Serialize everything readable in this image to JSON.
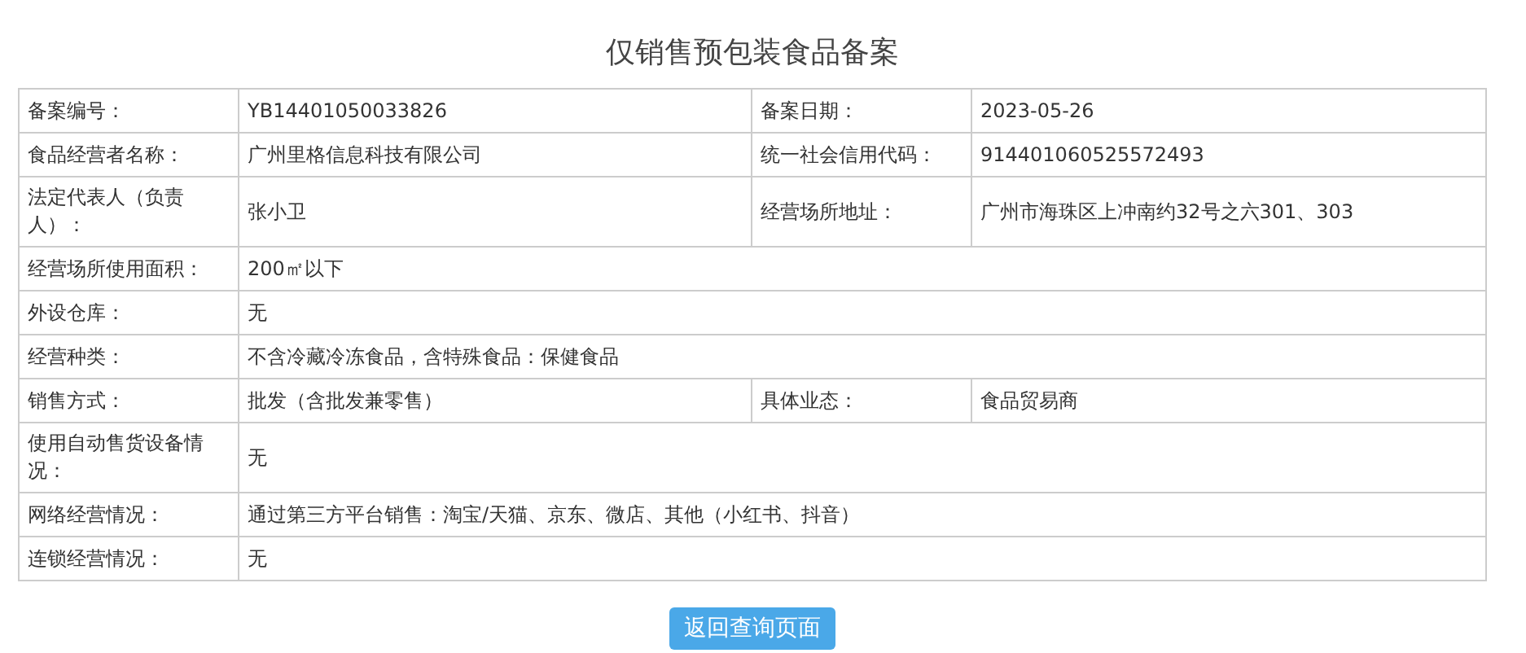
{
  "title": "仅销售预包装食品备案",
  "rows": [
    [
      {
        "label": "备案编号：",
        "value": "YB14401050033826"
      },
      {
        "label": "备案日期：",
        "value": "2023-05-26"
      }
    ],
    [
      {
        "label": "食品经营者名称：",
        "value": "广州里格信息科技有限公司"
      },
      {
        "label": "统一社会信用代码：",
        "value": "914401060525572493"
      }
    ],
    [
      {
        "label": "法定代表人（负责人）：",
        "value": "张小卫"
      },
      {
        "label": "经营场所地址：",
        "value": "广州市海珠区上冲南约32号之六301、303"
      }
    ],
    [
      {
        "label": "经营场所使用面积：",
        "value": "200㎡以下"
      }
    ],
    [
      {
        "label": "外设仓库：",
        "value": "无"
      }
    ],
    [
      {
        "label": "经营种类：",
        "value": "不含冷藏冷冻食品，含特殊食品：保健食品"
      }
    ],
    [
      {
        "label": "销售方式：",
        "value": "批发（含批发兼零售）"
      },
      {
        "label": "具体业态：",
        "value": "食品贸易商"
      }
    ],
    [
      {
        "label": "使用自动售货设备情况：",
        "value": "无"
      }
    ],
    [
      {
        "label": "网络经营情况：",
        "value": "通过第三方平台销售：淘宝/天猫、京东、微店、其他（小红书、抖音）"
      }
    ],
    [
      {
        "label": "连锁经营情况：",
        "value": "无"
      }
    ]
  ],
  "button": "返回查询页面"
}
